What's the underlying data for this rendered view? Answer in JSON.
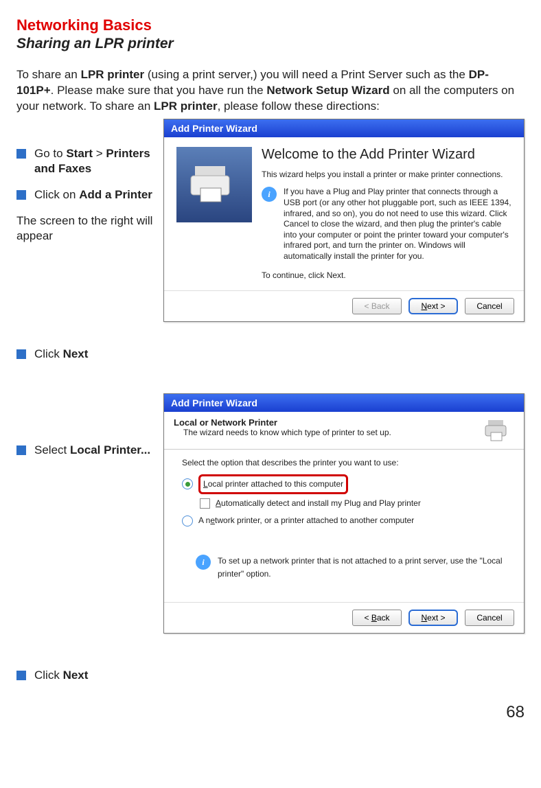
{
  "heading1": "Networking Basics",
  "heading2": "Sharing an LPR printer",
  "intro": {
    "t1": "To share an ",
    "b1": "LPR printer",
    "t2": " (using a print server,) you will need a Print Server such as the ",
    "b2": "DP-101P+",
    "t3": ".  Please make sure that you have run the ",
    "b3": "Network Setup Wizard",
    "t4": " on all the computers on your network. To share an ",
    "b4": "LPR printer",
    "t5": ", please follow these directions:"
  },
  "lcol": {
    "b1a": "Go to ",
    "b1b": "Start",
    "b1c": " > ",
    "b1d": "Printers and Faxes",
    "b2a": "Click on ",
    "b2b": "Add a Printer",
    "plain": "The screen to the right will appear",
    "b3a": "Click ",
    "b3b": "Next",
    "b4a": "Select ",
    "b4b": "Local Printer...",
    "b5a": "Click ",
    "b5b": "Next"
  },
  "d1": {
    "title": "Add Printer Wizard",
    "h": "Welcome to the Add Printer Wizard",
    "p1": "This wizard helps you install a printer or make printer connections.",
    "p2": "If you have a Plug and Play printer that connects through a USB port (or any other hot pluggable port, such as IEEE 1394, infrared, and so on), you do not need to use this wizard. Click Cancel to close the wizard, and then plug the printer's cable into your computer or point the printer toward your computer's infrared port, and turn the printer on. Windows will automatically install the printer for you.",
    "p3": "To continue, click Next.",
    "back": "< Back",
    "next": "Next >",
    "cancel": "Cancel"
  },
  "d2": {
    "title": "Add Printer Wizard",
    "hh": "Local or Network Printer",
    "hs": "The wizard needs to know which type of printer to set up.",
    "prompt": "Select the option that describes the printer you want to use:",
    "opt1a": "L",
    "opt1b": "ocal printer attached to this computer",
    "chk1a": "A",
    "chk1b": "utomatically detect and install my Plug and Play printer",
    "opt2a": "A n",
    "opt2b": "e",
    "opt2c": "twork printer, or a printer attached to another computer",
    "tip": "To set up a network printer that is not attached to a print server, use the \"Local printer\" option.",
    "back": "< Back",
    "next": "Next >",
    "cancel": "Cancel"
  },
  "page": "68"
}
